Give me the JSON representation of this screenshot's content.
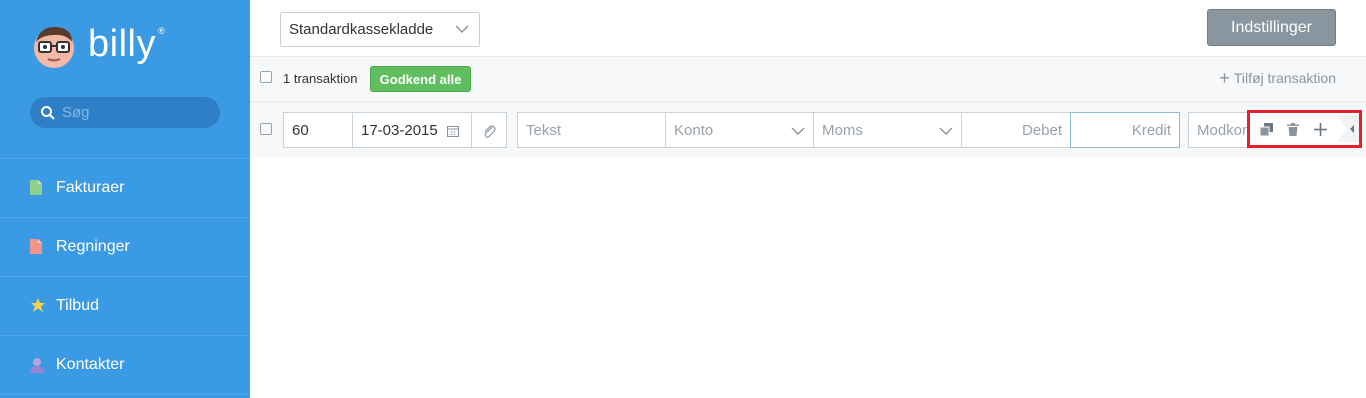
{
  "brand": {
    "name": "billy",
    "reg": "®"
  },
  "search": {
    "placeholder": "Søg"
  },
  "nav": {
    "items": [
      {
        "label": "Fakturaer",
        "icon": "invoice-icon"
      },
      {
        "label": "Regninger",
        "icon": "bill-icon"
      },
      {
        "label": "Tilbud",
        "icon": "star-icon"
      },
      {
        "label": "Kontakter",
        "icon": "person-icon"
      }
    ]
  },
  "topbar": {
    "book_select": "Standardkassekladde",
    "settings_label": "Indstillinger"
  },
  "toolbar": {
    "count_label": "1 transaktion",
    "approve_label": "Godkend alle",
    "add_label": "Tilføj transaktion"
  },
  "row": {
    "number": "60",
    "date": "17-03-2015",
    "text_placeholder": "Tekst",
    "account_placeholder": "Konto",
    "vat_placeholder": "Moms",
    "debit_placeholder": "Debet",
    "credit_placeholder": "Kredit",
    "contra_placeholder": "Modkonto"
  },
  "colors": {
    "sidebar": "#3a9ae3",
    "approve": "#5fbe5f",
    "settings": "#8a969f",
    "highlight": "#e3202b"
  }
}
